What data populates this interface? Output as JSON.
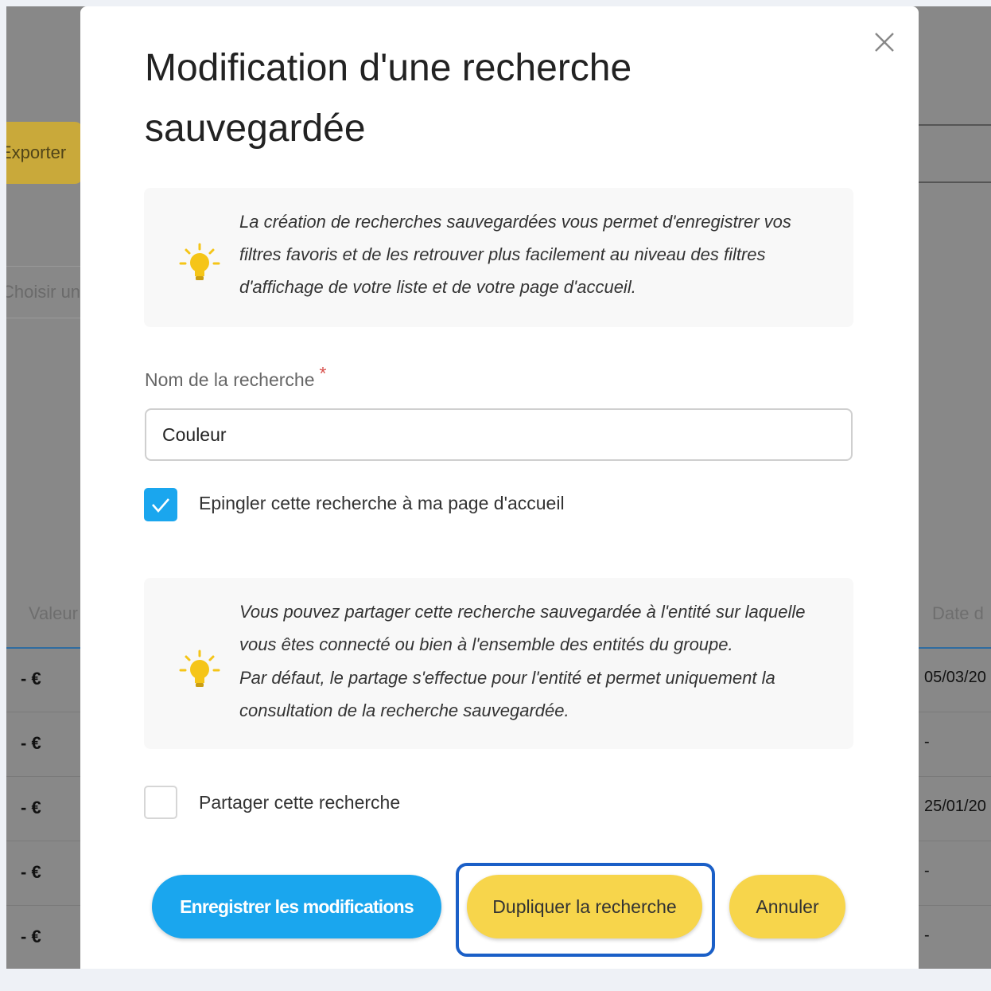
{
  "background": {
    "export_label": "Exporter",
    "search_placeholder": "Choisir un s",
    "column_left": "Valeur",
    "column_right": "Date d",
    "rows": [
      {
        "value": "- €",
        "date": "05/03/20"
      },
      {
        "value": "- €",
        "date": "-"
      },
      {
        "value": "- €",
        "date": "25/01/20"
      },
      {
        "value": "- €",
        "date": "-"
      },
      {
        "value": "- €",
        "date": "-"
      }
    ]
  },
  "modal": {
    "title": "Modification d'une recherche sauvegardée",
    "close_icon": "close-icon",
    "info_1": "La création de recherches sauvegardées vous permet d'enregistrer vos filtres favoris et de les retrouver plus facilement au niveau des filtres d'affichage de votre liste et de votre page d'accueil.",
    "name_label": "Nom de la recherche",
    "required_mark": "*",
    "name_value": "Couleur",
    "pin_label": "Epingler cette recherche à ma page d'accueil",
    "pin_checked": true,
    "info_2_line1": "Vous pouvez partager cette recherche sauvegardée à l'entité sur laquelle vous êtes connecté ou bien à l'ensemble des entités du groupe.",
    "info_2_line2": "Par défaut, le partage s'effectue pour l'entité et permet uniquement la consultation de la recherche sauvegardée.",
    "share_label": "Partager cette recherche",
    "share_checked": false,
    "buttons": {
      "save": "Enregistrer les modifications",
      "duplicate": "Dupliquer la recherche",
      "cancel": "Annuler"
    },
    "icons": {
      "info": "lightbulb-icon",
      "check": "checkmark-icon"
    }
  },
  "colors": {
    "primary": "#1aa6ee",
    "secondary": "#f7d54b",
    "focus": "#1a5fc7",
    "bulb": "#f5c518",
    "required": "#d9534f"
  }
}
